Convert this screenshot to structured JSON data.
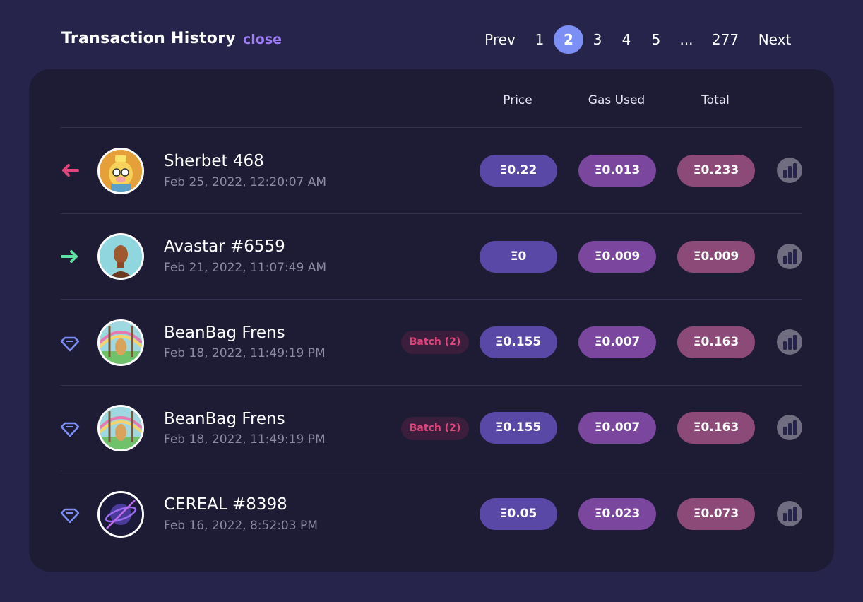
{
  "header": {
    "title": "Transaction History",
    "close_label": "close"
  },
  "pagination": {
    "prev": "Prev",
    "pages": [
      "1",
      "2",
      "3",
      "4",
      "5",
      "...",
      "277"
    ],
    "current": "2",
    "next": "Next"
  },
  "columns": {
    "price": "Price",
    "gas": "Gas Used",
    "total": "Total"
  },
  "colors": {
    "background": "#26244a",
    "card": "#1e1b35",
    "accent": "#9d7df2",
    "page_active": "#7b8ff5",
    "price_pill": "#5a48a6",
    "gas_pill": "#7a469e",
    "total_pill": "#8c4a78",
    "arrow_out": "#e0457b",
    "arrow_in": "#5fe0a0",
    "diamond": "#7b8ff5"
  },
  "transactions": [
    {
      "direction_icon": "arrow-left-icon",
      "avatar": "sherbet-avatar",
      "name": "Sherbet 468",
      "date": "Feb 25, 2022, 12:20:07 AM",
      "batch": "",
      "price": "Ξ0.22",
      "gas": "Ξ0.013",
      "total": "Ξ0.233"
    },
    {
      "direction_icon": "arrow-right-icon",
      "avatar": "avastar-avatar",
      "name": "Avastar #6559",
      "date": "Feb 21, 2022, 11:07:49 AM",
      "batch": "",
      "price": "Ξ0",
      "gas": "Ξ0.009",
      "total": "Ξ0.009"
    },
    {
      "direction_icon": "diamond-icon",
      "avatar": "beanbag-avatar",
      "name": "BeanBag Frens",
      "date": "Feb 18, 2022, 11:49:19 PM",
      "batch": "Batch (2)",
      "price": "Ξ0.155",
      "gas": "Ξ0.007",
      "total": "Ξ0.163"
    },
    {
      "direction_icon": "diamond-icon",
      "avatar": "beanbag-avatar",
      "name": "BeanBag Frens",
      "date": "Feb 18, 2022, 11:49:19 PM",
      "batch": "Batch (2)",
      "price": "Ξ0.155",
      "gas": "Ξ0.007",
      "total": "Ξ0.163"
    },
    {
      "direction_icon": "diamond-icon",
      "avatar": "cereal-avatar",
      "name": "CEREAL #8398",
      "date": "Feb 16, 2022, 8:52:03 PM",
      "batch": "",
      "price": "Ξ0.05",
      "gas": "Ξ0.023",
      "total": "Ξ0.073"
    }
  ]
}
